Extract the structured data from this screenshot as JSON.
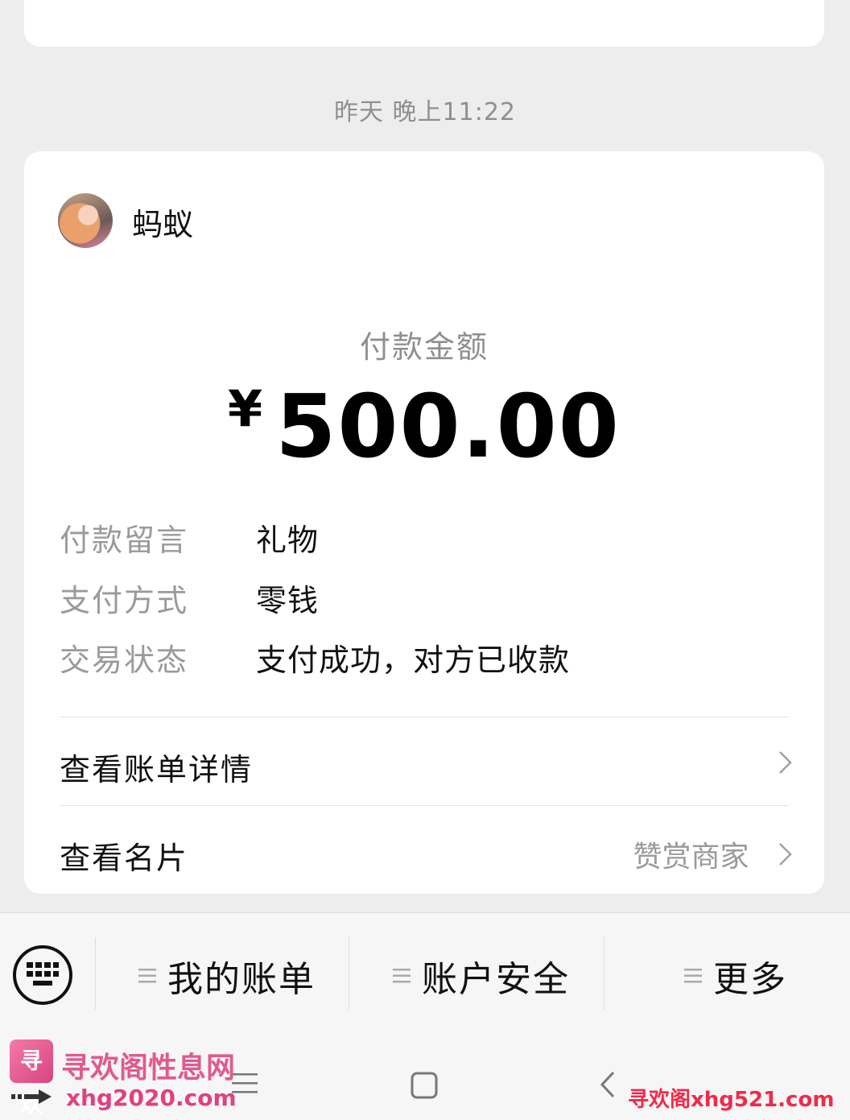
{
  "timestamp": "昨天 晚上11:22",
  "payment": {
    "sender_name": "蚂蚁",
    "amount_label": "付款金额",
    "currency": "¥",
    "amount": "500.00",
    "details": [
      {
        "key": "付款留言",
        "value": "礼物"
      },
      {
        "key": "支付方式",
        "value": "零钱"
      },
      {
        "key": "交易状态",
        "value": "支付成功，对方已收款"
      }
    ],
    "links": {
      "bill_detail": "查看账单详情",
      "card": "查看名片",
      "card_right": "赞赏商家"
    }
  },
  "menu": {
    "items": [
      "我的账单",
      "账户安全",
      "更多"
    ]
  },
  "watermark": {
    "logo_text": "寻欢",
    "title": "寻欢阁性息网",
    "url_left": "xhg2020.com",
    "url_right": "寻欢阁xhg521.com"
  }
}
